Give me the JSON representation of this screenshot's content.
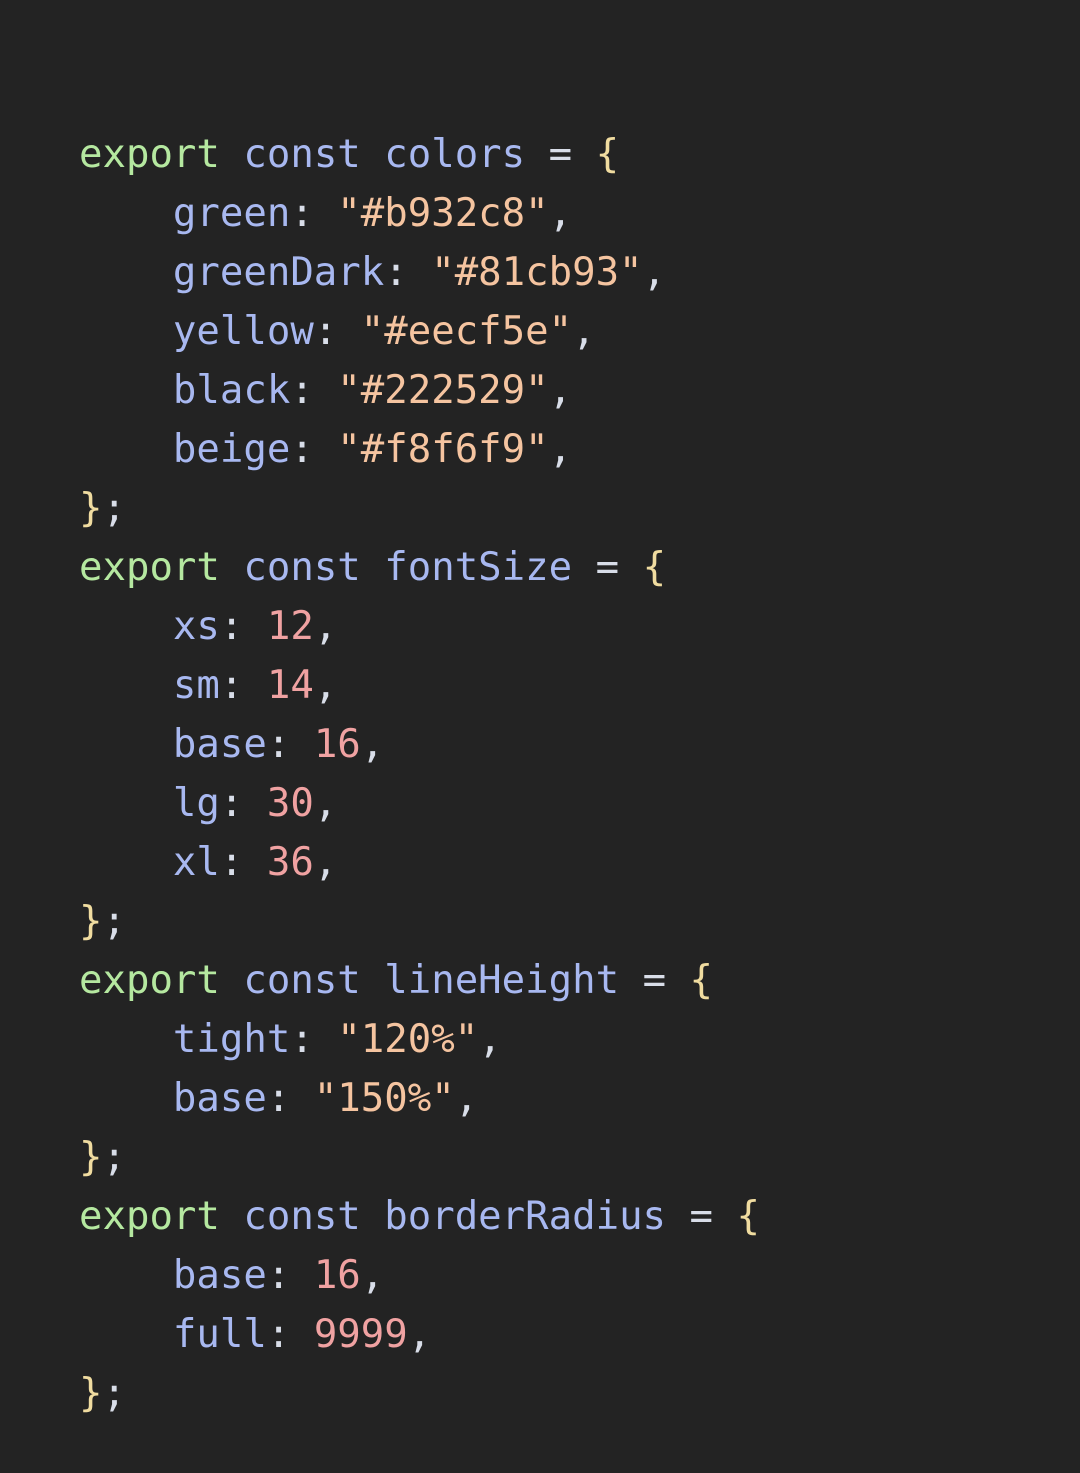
{
  "editor": {
    "language": "javascript",
    "theme_background": "#232323",
    "token_colors": {
      "keyword": "#b5e8a0",
      "declaration": "#a8b8f0",
      "property": "#a8b8f0",
      "string": "#f5c4a0",
      "number": "#f0a2a2",
      "brace": "#f0dca0",
      "punctuation": "#d8dde8"
    }
  },
  "code": {
    "lines": [
      {
        "indent": 0,
        "tokens": [
          {
            "text": "export",
            "type": "keyword"
          },
          {
            "text": " ",
            "type": "plain"
          },
          {
            "text": "const",
            "type": "declaration"
          },
          {
            "text": " ",
            "type": "plain"
          },
          {
            "text": "colors",
            "type": "identifier"
          },
          {
            "text": " ",
            "type": "plain"
          },
          {
            "text": "=",
            "type": "punct"
          },
          {
            "text": " ",
            "type": "plain"
          },
          {
            "text": "{",
            "type": "brace"
          }
        ]
      },
      {
        "indent": 1,
        "tokens": [
          {
            "text": "green",
            "type": "property"
          },
          {
            "text": ":",
            "type": "punct"
          },
          {
            "text": " ",
            "type": "plain"
          },
          {
            "text": "\"#b932c8\"",
            "type": "string"
          },
          {
            "text": ",",
            "type": "punct"
          }
        ]
      },
      {
        "indent": 1,
        "tokens": [
          {
            "text": "greenDark",
            "type": "property"
          },
          {
            "text": ":",
            "type": "punct"
          },
          {
            "text": " ",
            "type": "plain"
          },
          {
            "text": "\"#81cb93\"",
            "type": "string"
          },
          {
            "text": ",",
            "type": "punct"
          }
        ]
      },
      {
        "indent": 1,
        "tokens": [
          {
            "text": "yellow",
            "type": "property"
          },
          {
            "text": ":",
            "type": "punct"
          },
          {
            "text": " ",
            "type": "plain"
          },
          {
            "text": "\"#eecf5e\"",
            "type": "string"
          },
          {
            "text": ",",
            "type": "punct"
          }
        ]
      },
      {
        "indent": 1,
        "tokens": [
          {
            "text": "black",
            "type": "property"
          },
          {
            "text": ":",
            "type": "punct"
          },
          {
            "text": " ",
            "type": "plain"
          },
          {
            "text": "\"#222529\"",
            "type": "string"
          },
          {
            "text": ",",
            "type": "punct"
          }
        ]
      },
      {
        "indent": 1,
        "tokens": [
          {
            "text": "beige",
            "type": "property"
          },
          {
            "text": ":",
            "type": "punct"
          },
          {
            "text": " ",
            "type": "plain"
          },
          {
            "text": "\"#f8f6f9\"",
            "type": "string"
          },
          {
            "text": ",",
            "type": "punct"
          }
        ]
      },
      {
        "indent": 0,
        "tokens": [
          {
            "text": "}",
            "type": "brace"
          },
          {
            "text": ";",
            "type": "punct"
          }
        ]
      },
      {
        "indent": 0,
        "tokens": [
          {
            "text": "export",
            "type": "keyword"
          },
          {
            "text": " ",
            "type": "plain"
          },
          {
            "text": "const",
            "type": "declaration"
          },
          {
            "text": " ",
            "type": "plain"
          },
          {
            "text": "fontSize",
            "type": "identifier"
          },
          {
            "text": " ",
            "type": "plain"
          },
          {
            "text": "=",
            "type": "punct"
          },
          {
            "text": " ",
            "type": "plain"
          },
          {
            "text": "{",
            "type": "brace"
          }
        ]
      },
      {
        "indent": 1,
        "tokens": [
          {
            "text": "xs",
            "type": "property"
          },
          {
            "text": ":",
            "type": "punct"
          },
          {
            "text": " ",
            "type": "plain"
          },
          {
            "text": "12",
            "type": "number"
          },
          {
            "text": ",",
            "type": "punct"
          }
        ]
      },
      {
        "indent": 1,
        "tokens": [
          {
            "text": "sm",
            "type": "property"
          },
          {
            "text": ":",
            "type": "punct"
          },
          {
            "text": " ",
            "type": "plain"
          },
          {
            "text": "14",
            "type": "number"
          },
          {
            "text": ",",
            "type": "punct"
          }
        ]
      },
      {
        "indent": 1,
        "tokens": [
          {
            "text": "base",
            "type": "property"
          },
          {
            "text": ":",
            "type": "punct"
          },
          {
            "text": " ",
            "type": "plain"
          },
          {
            "text": "16",
            "type": "number"
          },
          {
            "text": ",",
            "type": "punct"
          }
        ]
      },
      {
        "indent": 1,
        "tokens": [
          {
            "text": "lg",
            "type": "property"
          },
          {
            "text": ":",
            "type": "punct"
          },
          {
            "text": " ",
            "type": "plain"
          },
          {
            "text": "30",
            "type": "number"
          },
          {
            "text": ",",
            "type": "punct"
          }
        ]
      },
      {
        "indent": 1,
        "tokens": [
          {
            "text": "xl",
            "type": "property"
          },
          {
            "text": ":",
            "type": "punct"
          },
          {
            "text": " ",
            "type": "plain"
          },
          {
            "text": "36",
            "type": "number"
          },
          {
            "text": ",",
            "type": "punct"
          }
        ]
      },
      {
        "indent": 0,
        "tokens": [
          {
            "text": "}",
            "type": "brace"
          },
          {
            "text": ";",
            "type": "punct"
          }
        ]
      },
      {
        "indent": 0,
        "tokens": [
          {
            "text": "export",
            "type": "keyword"
          },
          {
            "text": " ",
            "type": "plain"
          },
          {
            "text": "const",
            "type": "declaration"
          },
          {
            "text": " ",
            "type": "plain"
          },
          {
            "text": "lineHeight",
            "type": "identifier"
          },
          {
            "text": " ",
            "type": "plain"
          },
          {
            "text": "=",
            "type": "punct"
          },
          {
            "text": " ",
            "type": "plain"
          },
          {
            "text": "{",
            "type": "brace"
          }
        ]
      },
      {
        "indent": 1,
        "tokens": [
          {
            "text": "tight",
            "type": "property"
          },
          {
            "text": ":",
            "type": "punct"
          },
          {
            "text": " ",
            "type": "plain"
          },
          {
            "text": "\"120%\"",
            "type": "string"
          },
          {
            "text": ",",
            "type": "punct"
          }
        ]
      },
      {
        "indent": 1,
        "tokens": [
          {
            "text": "base",
            "type": "property"
          },
          {
            "text": ":",
            "type": "punct"
          },
          {
            "text": " ",
            "type": "plain"
          },
          {
            "text": "\"150%\"",
            "type": "string"
          },
          {
            "text": ",",
            "type": "punct"
          }
        ]
      },
      {
        "indent": 0,
        "tokens": [
          {
            "text": "}",
            "type": "brace"
          },
          {
            "text": ";",
            "type": "punct"
          }
        ]
      },
      {
        "indent": 0,
        "tokens": [
          {
            "text": "export",
            "type": "keyword"
          },
          {
            "text": " ",
            "type": "plain"
          },
          {
            "text": "const",
            "type": "declaration"
          },
          {
            "text": " ",
            "type": "plain"
          },
          {
            "text": "borderRadius",
            "type": "identifier"
          },
          {
            "text": " ",
            "type": "plain"
          },
          {
            "text": "=",
            "type": "punct"
          },
          {
            "text": " ",
            "type": "plain"
          },
          {
            "text": "{",
            "type": "brace"
          }
        ]
      },
      {
        "indent": 1,
        "tokens": [
          {
            "text": "base",
            "type": "property"
          },
          {
            "text": ":",
            "type": "punct"
          },
          {
            "text": " ",
            "type": "plain"
          },
          {
            "text": "16",
            "type": "number"
          },
          {
            "text": ",",
            "type": "punct"
          }
        ]
      },
      {
        "indent": 1,
        "tokens": [
          {
            "text": "full",
            "type": "property"
          },
          {
            "text": ":",
            "type": "punct"
          },
          {
            "text": " ",
            "type": "plain"
          },
          {
            "text": "9999",
            "type": "number"
          },
          {
            "text": ",",
            "type": "punct"
          }
        ]
      },
      {
        "indent": 0,
        "tokens": [
          {
            "text": "}",
            "type": "brace"
          },
          {
            "text": ";",
            "type": "punct"
          }
        ]
      }
    ]
  }
}
